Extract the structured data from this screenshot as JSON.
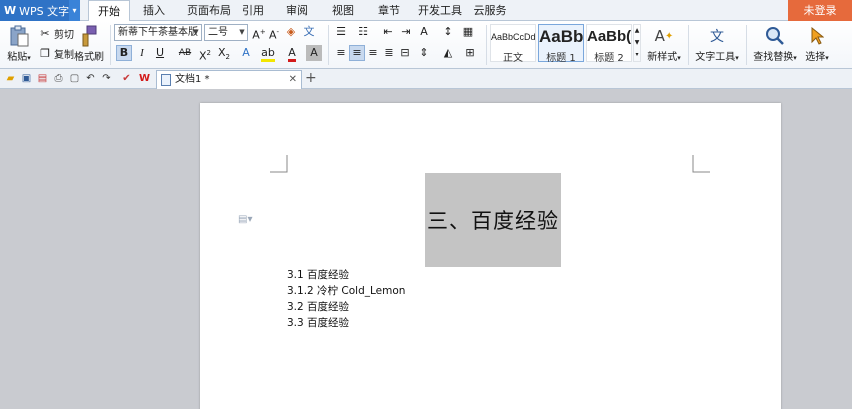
{
  "app": {
    "name": "WPS 文字",
    "login": "未登录"
  },
  "menu": [
    "开始",
    "插入",
    "页面布局",
    "引用",
    "审阅",
    "视图",
    "章节",
    "开发工具",
    "云服务"
  ],
  "ribbon": {
    "paste": "粘贴",
    "cut": "剪切",
    "copy": "复制",
    "format_painter": "格式刷",
    "font_name": "新蒂下午茶基本版",
    "font_size": "二号",
    "styles": [
      {
        "sample": "AaBbCcDd",
        "label": "正文"
      },
      {
        "sample": "AaBb",
        "label": "标题 1"
      },
      {
        "sample": "AaBb(",
        "label": "标题 2"
      }
    ],
    "new_style": "新样式",
    "text_tools": "文字工具",
    "find_replace": "查找替换",
    "select": "选择"
  },
  "tabs": {
    "doc_title": "文档1 *"
  },
  "document": {
    "heading_image_text": "三、百度经验",
    "toc": [
      "3.1 百度经验",
      "3.1.2 冷柠 Cold_Lemon",
      "3.2 百度经验",
      "3.3 百度经验"
    ]
  },
  "colors": {
    "accent": "#2f73c6",
    "login": "#e66a3c",
    "highlight": "#f3e600",
    "font_color": "#d31a1a"
  }
}
